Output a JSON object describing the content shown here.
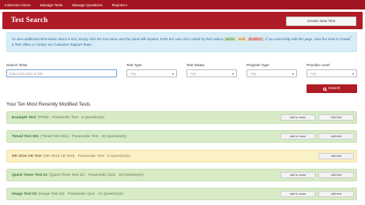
{
  "nav": {
    "items": [
      "Instructor Home",
      "Manage Tests",
      "Manage Questions",
      "Reports"
    ],
    "reports_caret": "▾"
  },
  "banner": {
    "title": "Test Search",
    "create_button": "Create New Test"
  },
  "info": {
    "text_1": "To view additional information about a test, simply click the test name and the panel will expand. Tests are now color coded by their status (",
    "active": "active",
    "comma_1": ", ",
    "draft": "draft",
    "comma_2": ", ",
    "disabled": "disabled",
    "text_2": "). If you need help with this page, view the ",
    "link_1": "How to Create a Test Video",
    "text_3": " or contact our ",
    "link_2": "Customer Support Team",
    "text_4": ".",
    "close": "×"
  },
  "filters": {
    "search_label": "Search Tests",
    "search_placeholder": "Enter test name or title",
    "type_label": "Test Type",
    "status_label": "Test Status",
    "program_label": "Program Type",
    "provider_label": "Provider Level",
    "any": "Any",
    "arrow": "▾",
    "search_button": "Search"
  },
  "section_heading": "Your Ten Most Recently Modified Tests",
  "row_buttons": {
    "add": "add to class",
    "edit": "edit test"
  },
  "tests": [
    {
      "name": "Example Test",
      "meta": "(TRW) · Paramedic Test · 5 Question(s)",
      "status": "green",
      "add": true
    },
    {
      "name": "Timed Test 001",
      "meta": "(Timed Test 001) · Paramedic Test · 20 Question(s)",
      "status": "green",
      "add": true
    },
    {
      "name": "NR 2015 AB Test",
      "meta": "(NR 2015 AB Test) · Paramedic Test · 0 Question(s)",
      "status": "yellow",
      "add": false
    },
    {
      "name": "Quick Timer Test 01",
      "meta": "(Quick Timer Test 01) · Paramedic Quiz · 20 Question(s)",
      "status": "green",
      "add": true
    },
    {
      "name": "Image Test 02",
      "meta": "(Image Test 02) · Paramedic Quiz · 21 Question(s)",
      "status": "green",
      "add": true
    }
  ]
}
